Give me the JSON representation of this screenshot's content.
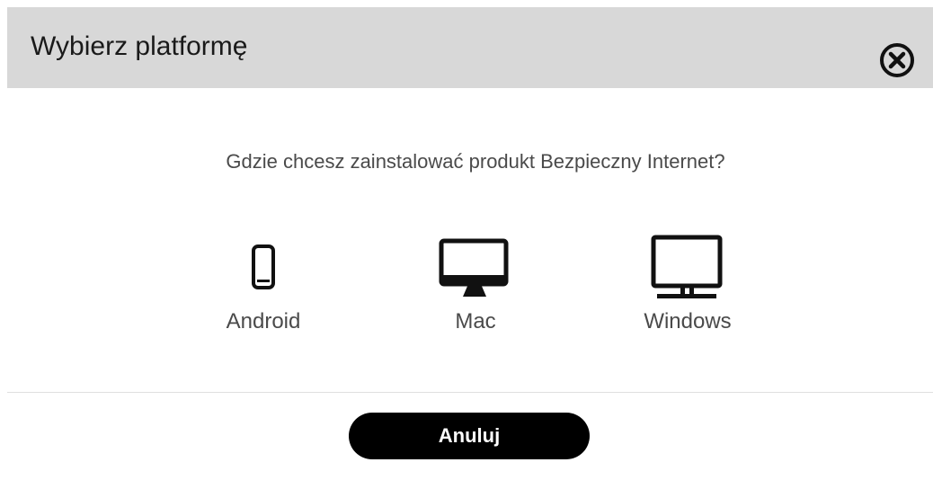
{
  "dialog": {
    "title": "Wybierz platformę",
    "close_icon": "close-circle-icon",
    "question": "Gdzie chcesz zainstalować produkt Bezpieczny Internet?",
    "platforms": [
      {
        "label": "Android",
        "icon": "smartphone-icon"
      },
      {
        "label": "Mac",
        "icon": "imac-monitor-icon"
      },
      {
        "label": "Windows",
        "icon": "pc-monitor-icon"
      }
    ],
    "cancel_label": "Anuluj"
  },
  "colors": {
    "header_background": "#d8d8d8",
    "button_background": "#000000",
    "button_text": "#ffffff",
    "text": "#4a4a4a"
  }
}
